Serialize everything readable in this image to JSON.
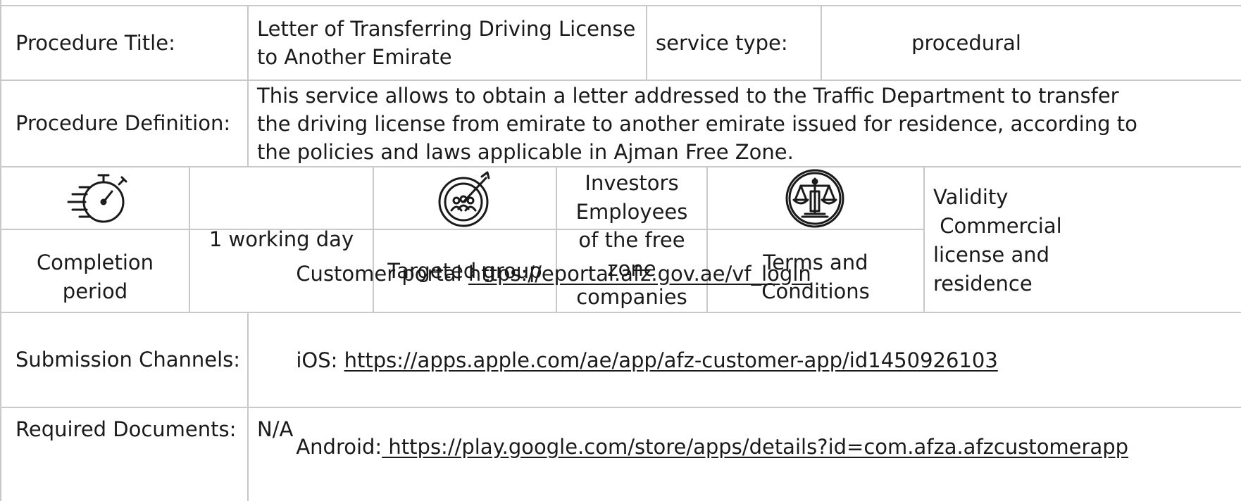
{
  "procedure": {
    "title_label": "Procedure Title:",
    "title_line1": "Letter of Transferring Driving License",
    "title_line2": "to Another Emirate",
    "service_type_label": "service type:",
    "service_type_value": "procedural",
    "definition_label": "Procedure Definition:",
    "definition_line1": "This service allows to obtain a letter addressed to the Traffic Department to transfer",
    "definition_line2": "the driving license from emirate to another emirate issued for residence, according to",
    "definition_line3": "the policies and laws applicable in Ajman Free Zone."
  },
  "info": {
    "completion_label_line1": "Completion",
    "completion_label_line2": "period",
    "completion_value": "1 working day",
    "targeted_label": "Targeted group",
    "targeted_line1": "Investors",
    "targeted_line2": "Employees",
    "targeted_line3": "of the free",
    "targeted_line4": "zone",
    "targeted_line5": "companies",
    "terms_label_line1": "Terms and",
    "terms_label_line2": "Conditions",
    "terms_line1": "Validity",
    "terms_line2": " Commercial",
    "terms_line3": "license and",
    "terms_line4": "residence",
    "icons": {
      "completion": "stopwatch-icon",
      "targeted": "target-group-icon",
      "terms": "scales-of-justice-icon"
    }
  },
  "submission": {
    "label": "Submission Channels:",
    "portal_prefix": "Customer portal ",
    "portal_link": "https://eportal.afz.gov.ae/vf_login",
    "ios_prefix": "iOS: ",
    "ios_link": "https://apps.apple.com/ae/app/afz-customer-app/id1450926103",
    "android_prefix": "Android:",
    "android_link": " https://play.google.com/store/apps/details?id=com.afza.afzcustomerapp"
  },
  "documents": {
    "label": "Required Documents:",
    "value": "N/A"
  },
  "colors": {
    "grid": "#c9c9c9",
    "text": "#1a1a1a",
    "background": "#ffffff"
  }
}
